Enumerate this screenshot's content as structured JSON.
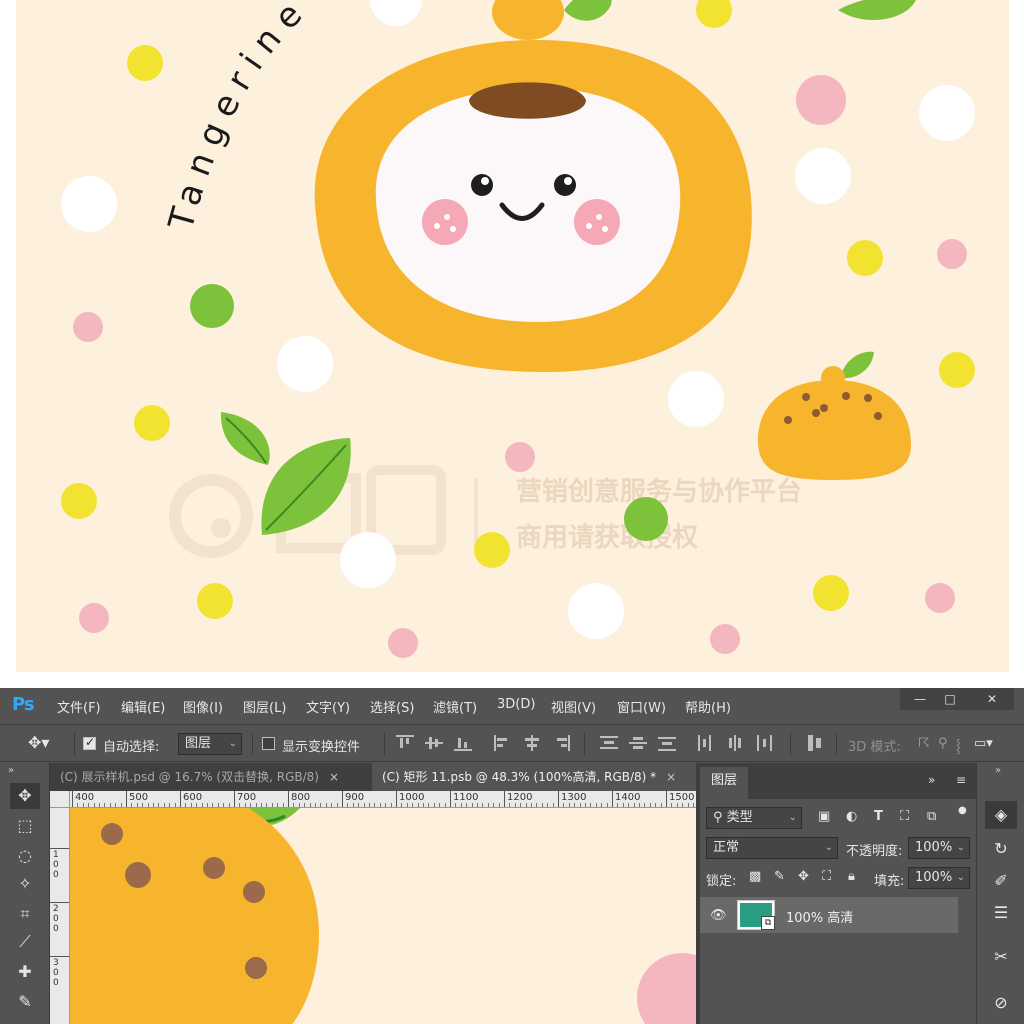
{
  "illustration": {
    "title_text": "Tangerine",
    "watermark": {
      "line1": "营销创意服务与协作平台",
      "line2": "商用请获取授权"
    },
    "colors": {
      "background": "#fdf0dc",
      "orange": "#f7b52d",
      "leaf": "#7cc23a",
      "pink": "#f4b6bf",
      "yellow": "#f2e331",
      "white": "#ffffff"
    }
  },
  "photoshop": {
    "app_logo": "Ps",
    "menu": [
      "文件(F)",
      "编辑(E)",
      "图像(I)",
      "图层(L)",
      "文字(Y)",
      "选择(S)",
      "滤镜(T)",
      "3D(D)",
      "视图(V)",
      "窗口(W)",
      "帮助(H)"
    ],
    "window_controls": {
      "minimize": "—",
      "maximize": "□",
      "close": "✕"
    },
    "options_bar": {
      "auto_select_label": "自动选择:",
      "auto_select_checked": true,
      "auto_select_target": "图层",
      "show_transform_label": "显示变换控件",
      "show_transform_checked": false,
      "mode_3d_label": "3D 模式:"
    },
    "tabs": [
      {
        "label": "(C) 展示样机.psd @ 16.7% (双击替换, RGB/8)",
        "close": "×",
        "active": false
      },
      {
        "label": "(C) 矩形 11.psb @ 48.3% (100%高清, RGB/8) *",
        "close": "×",
        "active": true
      }
    ],
    "ruler": {
      "horizontal": [
        "400",
        "500",
        "600",
        "700",
        "800",
        "900",
        "1000",
        "1100",
        "1200",
        "1300",
        "1400",
        "1500"
      ],
      "vertical": [
        "100",
        "200",
        "300"
      ]
    },
    "tools": [
      {
        "name": "move-tool",
        "glyph": "✥"
      },
      {
        "name": "marquee-tool",
        "glyph": "⬚"
      },
      {
        "name": "lasso-tool",
        "glyph": "◌"
      },
      {
        "name": "magic-wand-tool",
        "glyph": "✧"
      },
      {
        "name": "crop-tool",
        "glyph": "⌗"
      },
      {
        "name": "eyedropper-tool",
        "glyph": "⟋"
      },
      {
        "name": "healing-tool",
        "glyph": "✚"
      },
      {
        "name": "brush-tool",
        "glyph": "✎"
      }
    ],
    "layers_panel": {
      "tab_label": "图层",
      "filter_kind": "类型",
      "blend_mode": "正常",
      "opacity_label": "不透明度:",
      "opacity_value": "100%",
      "lock_label": "锁定:",
      "fill_label": "填充:",
      "fill_value": "100%",
      "collapse_glyph": "»",
      "menu_glyph": "≡",
      "layers": [
        {
          "name": "100% 高清",
          "visible": true,
          "thumb_color": "#2a9e84"
        }
      ]
    }
  }
}
